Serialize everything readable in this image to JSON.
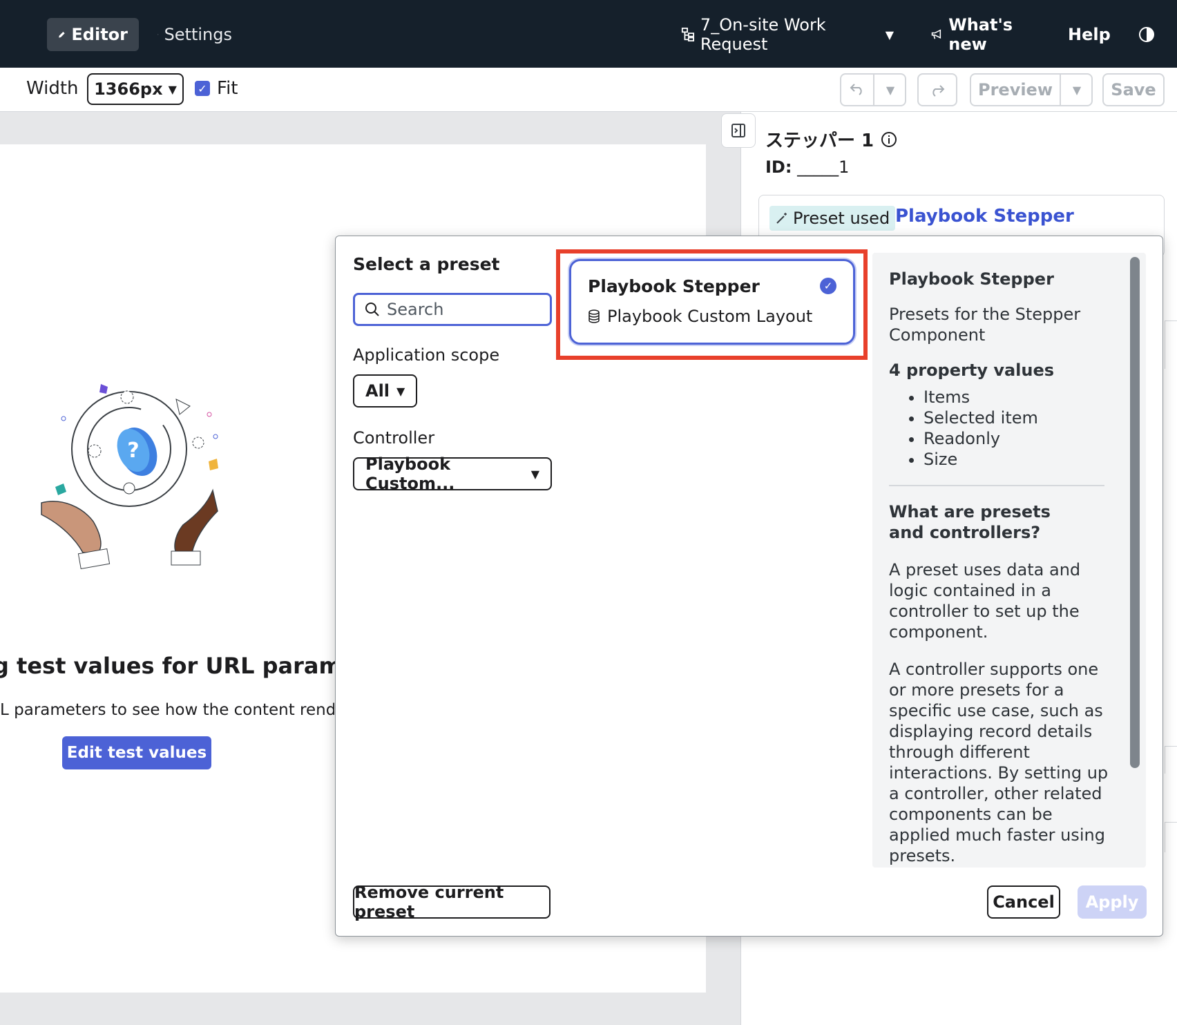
{
  "topbar": {
    "editor_label": "Editor",
    "settings_label": "Settings",
    "app_name": "7_On-site Work Request",
    "whats_new_label": "What's new",
    "help_label": "Help"
  },
  "toolbar": {
    "width_label": "Width",
    "width_value": "1366px",
    "fit_label": "Fit",
    "fit_checked": true,
    "preview_label": "Preview",
    "save_label": "Save"
  },
  "canvas": {
    "empty_title": "g test values for URL parameters",
    "empty_subtitle": "L parameters to see how the content renders",
    "edit_button_label": "Edit test values"
  },
  "side_panel": {
    "title": "ステッパー 1",
    "id_label": "ID:",
    "id_value": "_____1",
    "preset_tag": "Preset used",
    "preset_name": "Playbook Stepper"
  },
  "modal": {
    "heading": "Select a preset",
    "search_placeholder": "Search",
    "scope_label": "Application scope",
    "scope_value": "All",
    "controller_label": "Controller",
    "controller_value": "Playbook Custom...",
    "option": {
      "title": "Playbook Stepper",
      "subtitle": "Playbook Custom Layout",
      "selected": true
    },
    "info": {
      "title": "Playbook Stepper",
      "description": "Presets for the Stepper Component",
      "property_count": "4 property values",
      "properties": [
        "Items",
        "Selected item",
        "Readonly",
        "Size"
      ],
      "what_heading": "What are presets and controllers?",
      "para1": "A preset uses data and logic contained in a controller to set up the component.",
      "para2": "A controller supports one or more presets for a specific use case, such as displaying record details through different interactions. By setting up a controller, other related components can be applied much faster using presets."
    },
    "remove_label": "Remove current preset",
    "cancel_label": "Cancel",
    "apply_label": "Apply"
  },
  "colors": {
    "nav_bg": "#15202b",
    "accent": "#4c62d6",
    "highlight": "#e8402b",
    "link": "#3a53d1"
  },
  "icons": [
    "pencil-icon",
    "gear-icon",
    "tree-icon",
    "chevron-down-icon",
    "megaphone-icon",
    "help-icon",
    "contrast-icon",
    "undo-icon",
    "redo-icon",
    "panel-collapse-icon",
    "info-icon",
    "wand-icon",
    "search-icon",
    "database-icon",
    "check-icon"
  ]
}
